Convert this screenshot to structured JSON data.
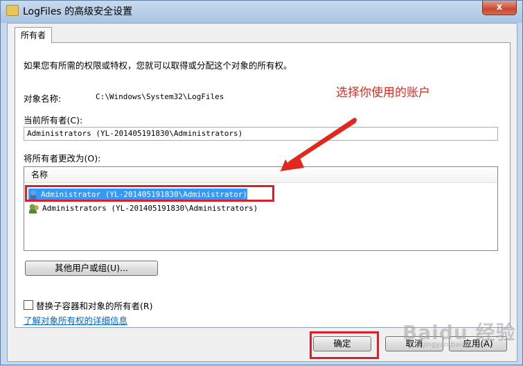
{
  "window": {
    "title": "LogFiles 的高级安全设置",
    "close_label": "x"
  },
  "tab": {
    "label": "所有者"
  },
  "description": "如果您有所需的权限或特权，您就可以取得或分配这个对象的所有权。",
  "object_name": {
    "label": "对象名称:",
    "value": "C:\\Windows\\System32\\LogFiles"
  },
  "current_owner": {
    "label": "当前所有者(C):",
    "value": "Administrators (YL-201405191830\\Administrators)"
  },
  "change_owner": {
    "label": "将所有者更改为(O):",
    "column_header": "名称",
    "items": [
      {
        "label": "Administrator (YL-201405191830\\Administrator)",
        "icon": "user-icon",
        "selected": true
      },
      {
        "label": "Administrators (YL-201405191830\\Administrators)",
        "icon": "users-icon",
        "selected": false
      }
    ]
  },
  "other_users_button": "其他用户或组(U)...",
  "replace_checkbox": {
    "label": "替换子容器和对象的所有者(R)",
    "checked": false
  },
  "details_link": "了解对象所有权的详细信息",
  "footer": {
    "ok": "确定",
    "cancel": "取消",
    "apply": "应用(A)"
  },
  "annotation": {
    "text": "选择你使用的账户",
    "color": "#e0281e"
  },
  "watermark": {
    "text": "Baidu 经验",
    "sub": "jingyan.baidu.com"
  }
}
